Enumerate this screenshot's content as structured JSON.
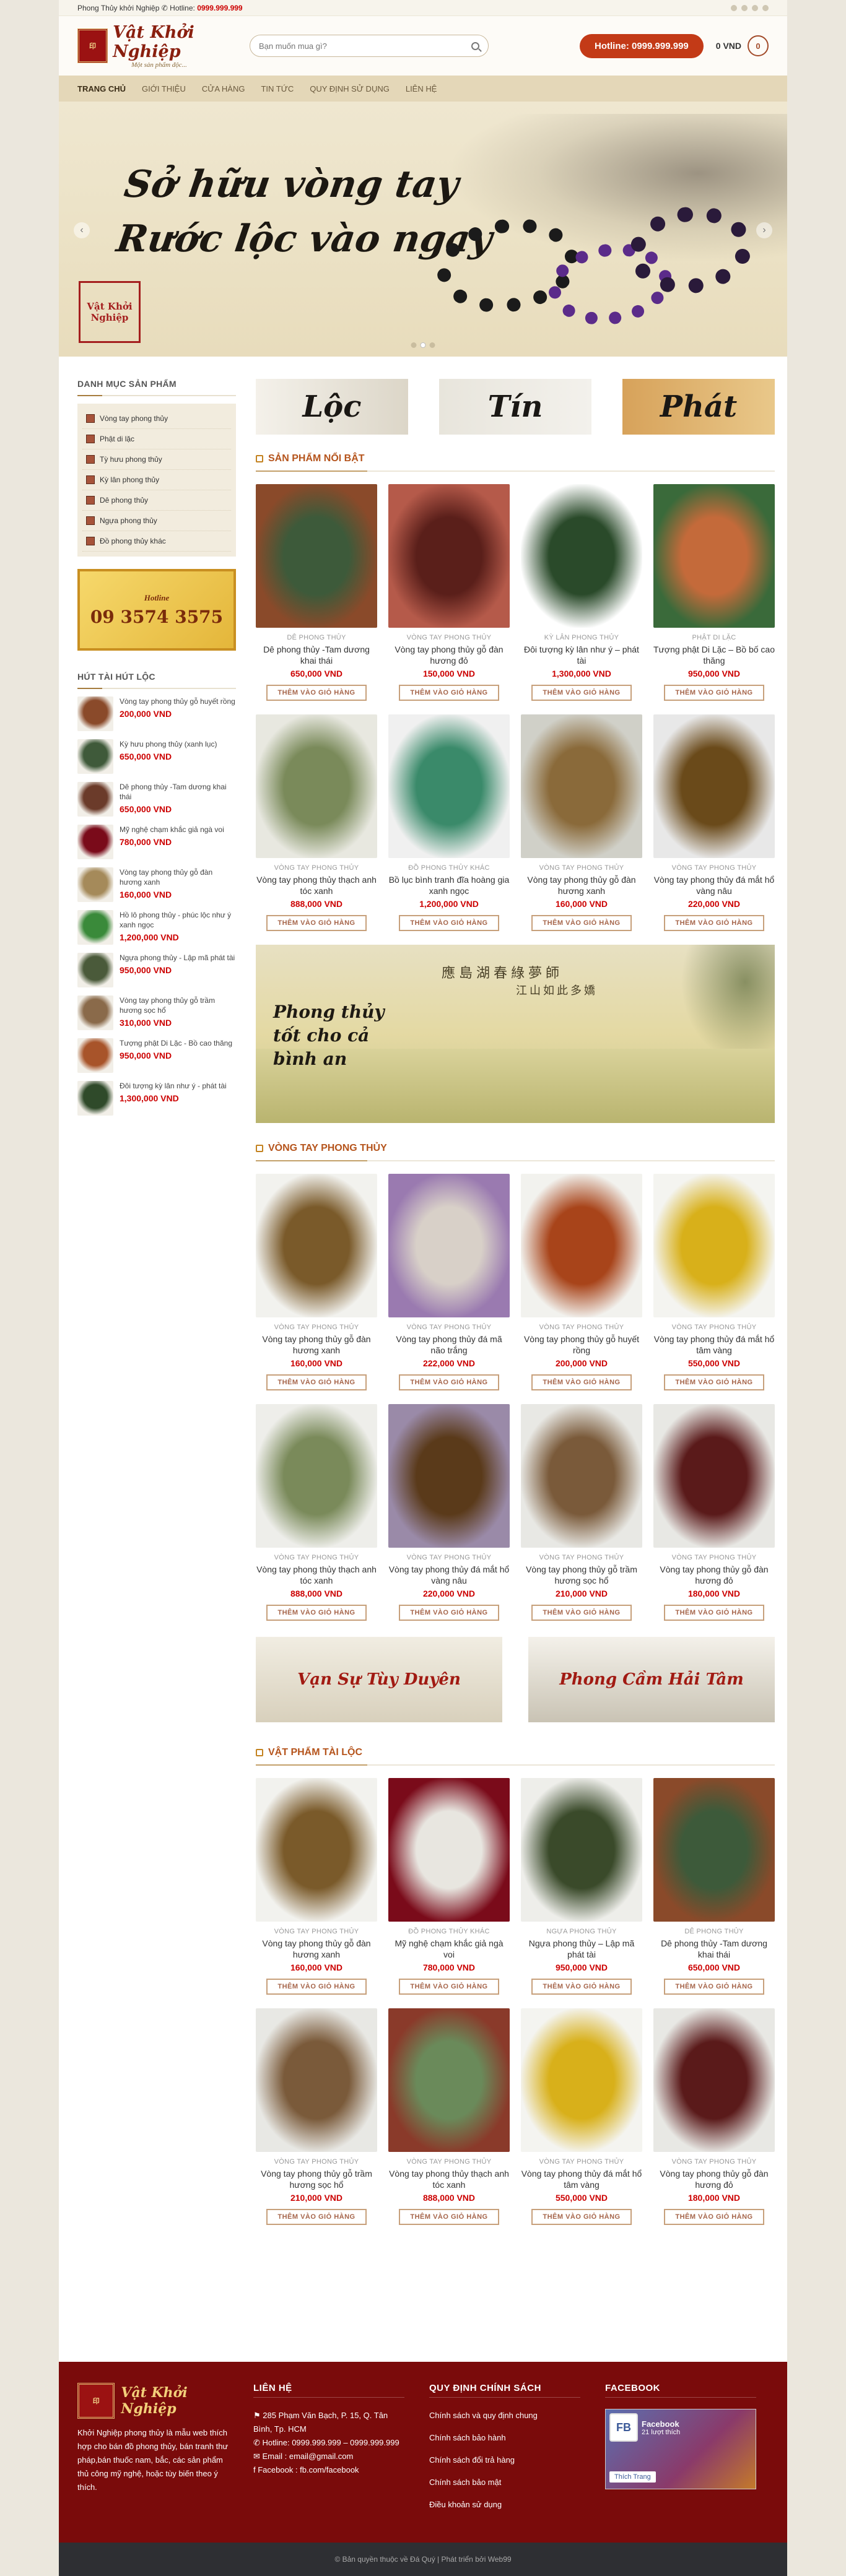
{
  "topbar": {
    "text": "Phong Thủy khởi Nghiệp",
    "hotline_label": "Hotline:",
    "hotline": "0999.999.999"
  },
  "header": {
    "brand": "Vật Khởi Nghiệp",
    "slogan": "Một sản phẩm độc...",
    "search_placeholder": "Bạn muốn mua gì?",
    "hotline_button": "Hotline: 0999.999.999",
    "cart_total": "0 VND",
    "cart_count": "0"
  },
  "nav": [
    "TRANG CHỦ",
    "GIỚI THIỆU",
    "CỬA HÀNG",
    "TIN TỨC",
    "QUY ĐỊNH SỬ DỤNG",
    "LIÊN HỆ"
  ],
  "banner": {
    "line1": "Sở hữu vòng tay",
    "line2": "Rước lộc vào ngay",
    "seal": "Vật Khởi Nghiệp"
  },
  "sidebar": {
    "cat_title": "DANH MỤC SẢN PHẨM",
    "categories": [
      "Vòng tay phong thủy",
      "Phật di lặc",
      "Tỳ hưu phong thủy",
      "Kỳ lân phong thủy",
      "Dê phong thủy",
      "Ngựa phong thủy",
      "Đồ phong thủy khác"
    ],
    "hotbox_label": "Hotline",
    "hotbox_number": "09 3574 3575",
    "hot_title": "HÚT TÀI HÚT LỘC",
    "hot_products": [
      {
        "name": "Vòng tay phong thủy gỗ huyết rồng",
        "price": "200,000 VND",
        "color": "#8a4a2a"
      },
      {
        "name": "Kỳ hưu phong thủy (xanh lục)",
        "price": "650,000 VND",
        "color": "#3f5a3a"
      },
      {
        "name": "Dê phong thủy -Tam dương khai thái",
        "price": "650,000 VND",
        "color": "#6b3b2a"
      },
      {
        "name": "Mỹ nghệ chạm khắc giả ngà voi",
        "price": "780,000 VND",
        "color": "#7a0b1a"
      },
      {
        "name": "Vòng tay phong thủy gỗ đàn hương xanh",
        "price": "160,000 VND",
        "color": "#a58a5a"
      },
      {
        "name": "Hồ lô phong thủy - phúc lộc như ý xanh ngọc",
        "price": "1,200,000 VND",
        "color": "#3a8a3a"
      },
      {
        "name": "Ngựa phong thủy - Lập mã phát tài",
        "price": "950,000 VND",
        "color": "#4a5a3a"
      },
      {
        "name": "Vòng tay phong thủy gỗ trầm hương sọc hổ",
        "price": "310,000 VND",
        "color": "#8a6a4a"
      },
      {
        "name": "Tượng phật Di Lặc - Bồ cao thăng",
        "price": "950,000 VND",
        "color": "#a8542a"
      },
      {
        "name": "Đôi tượng kỳ lân như ý - phát tài",
        "price": "1,300,000 VND",
        "color": "#2f4a2a"
      }
    ]
  },
  "features": [
    "Lộc",
    "Tín",
    "Phát"
  ],
  "sections": [
    {
      "title": "SẢN PHẨM NỔI BẬT",
      "products": [
        {
          "cat": "DÊ PHONG THỦY",
          "name": "Dê phong thủy -Tam dương khai thái",
          "price": "650,000 VND",
          "c1": "#3d5a3a",
          "c2": "#8a4a2a"
        },
        {
          "cat": "VÒNG TAY PHONG THỦY",
          "name": "Vòng tay phong thủy gỗ đàn hương đỏ",
          "price": "150,000 VND",
          "c1": "#5a1f1a",
          "c2": "#b55a4a"
        },
        {
          "cat": "KỲ LÂN PHONG THỦY",
          "name": "Đôi tượng kỳ lân như ý – phát tài",
          "price": "1,300,000 VND",
          "c1": "#2a4a2a",
          "c2": "#ffffff"
        },
        {
          "cat": "PHẬT DI LẶC",
          "name": "Tượng phật Di Lặc – Bồ bố cao thăng",
          "price": "950,000 VND",
          "c1": "#c46a3a",
          "c2": "#3a6a3a"
        },
        {
          "cat": "VÒNG TAY PHONG THỦY",
          "name": "Vòng tay phong thủy thạch anh tóc xanh",
          "price": "888,000 VND",
          "c1": "#7a8a5a",
          "c2": "#e8e8e0"
        },
        {
          "cat": "ĐỒ PHONG THỦY KHÁC",
          "name": "Bồ lục bình tranh đĩa hoàng gia xanh ngọc",
          "price": "1,200,000 VND",
          "c1": "#3a8a6a",
          "c2": "#f0f0f0"
        },
        {
          "cat": "VÒNG TAY PHONG THỦY",
          "name": "Vòng tay phong thủy gỗ đàn hương xanh",
          "price": "160,000 VND",
          "c1": "#8a6a3a",
          "c2": "#d0d0c8"
        },
        {
          "cat": "VÒNG TAY PHONG THỦY",
          "name": "Vòng tay phong thủy đá mắt hổ vàng nâu",
          "price": "220,000 VND",
          "c1": "#6a4a1a",
          "c2": "#e8e8e8"
        }
      ]
    },
    {
      "title": "VÒNG TAY PHONG THỦY",
      "products": [
        {
          "cat": "VÒNG TAY PHONG THỦY",
          "name": "Vòng tay phong thủy gỗ đàn hương xanh",
          "price": "160,000 VND",
          "c1": "#7a5a2a",
          "c2": "#f2f2ee"
        },
        {
          "cat": "VÒNG TAY PHONG THỦY",
          "name": "Vòng tay phong thủy đá mã não trắng",
          "price": "222,000 VND",
          "c1": "#d8d0c8",
          "c2": "#9a7ab0"
        },
        {
          "cat": "VÒNG TAY PHONG THỦY",
          "name": "Vòng tay phong thủy gỗ huyết rồng",
          "price": "200,000 VND",
          "c1": "#a8441a",
          "c2": "#f2f2ee"
        },
        {
          "cat": "VÒNG TAY PHONG THỦY",
          "name": "Vòng tay phong thủy đá mắt hổ tâm vàng",
          "price": "550,000 VND",
          "c1": "#d8b01a",
          "c2": "#f4f4f0"
        },
        {
          "cat": "VÒNG TAY PHONG THỦY",
          "name": "Vòng tay phong thủy thạch anh tóc xanh",
          "price": "888,000 VND",
          "c1": "#7a8a5a",
          "c2": "#eeeeea"
        },
        {
          "cat": "VÒNG TAY PHONG THỦY",
          "name": "Vòng tay phong thủy đá mắt hổ vàng nâu",
          "price": "220,000 VND",
          "c1": "#5a3a1a",
          "c2": "#9a8aa8"
        },
        {
          "cat": "VÒNG TAY PHONG THỦY",
          "name": "Vòng tay phong thủy gỗ trầm hương sọc hổ",
          "price": "210,000 VND",
          "c1": "#7a5a3a",
          "c2": "#e8e8e4"
        },
        {
          "cat": "VÒNG TAY PHONG THỦY",
          "name": "Vòng tay phong thủy gỗ đàn hương đỏ",
          "price": "180,000 VND",
          "c1": "#5a1a1a",
          "c2": "#e8e8e4"
        }
      ]
    },
    {
      "title": "VẬT PHẨM TÀI LỘC",
      "products": [
        {
          "cat": "VÒNG TAY PHONG THỦY",
          "name": "Vòng tay phong thủy gỗ đàn hương xanh",
          "price": "160,000 VND",
          "c1": "#7a5a2a",
          "c2": "#f2f2ee"
        },
        {
          "cat": "ĐỒ PHONG THỦY KHÁC",
          "name": "Mỹ nghệ chạm khắc giả ngà voi",
          "price": "780,000 VND",
          "c1": "#e8e6e0",
          "c2": "#7a0b1a"
        },
        {
          "cat": "NGỰA PHONG THỦY",
          "name": "Ngựa phong thủy – Lập mã phát tài",
          "price": "950,000 VND",
          "c1": "#3a4a2a",
          "c2": "#eeeeea"
        },
        {
          "cat": "DÊ PHONG THỦY",
          "name": "Dê phong thủy -Tam dương khai thái",
          "price": "650,000 VND",
          "c1": "#3d5a3a",
          "c2": "#8a4a2a"
        },
        {
          "cat": "VÒNG TAY PHONG THỦY",
          "name": "Vòng tay phong thủy gỗ trầm hương sọc hổ",
          "price": "210,000 VND",
          "c1": "#7a5a3a",
          "c2": "#e8e8e4"
        },
        {
          "cat": "VÒNG TAY PHONG THỦY",
          "name": "Vòng tay phong thủy thạch anh tóc xanh",
          "price": "888,000 VND",
          "c1": "#6a8a5a",
          "c2": "#8a3a2a"
        },
        {
          "cat": "VÒNG TAY PHONG THỦY",
          "name": "Vòng tay phong thủy đá mắt hổ tâm vàng",
          "price": "550,000 VND",
          "c1": "#d8b01a",
          "c2": "#f4f4f0"
        },
        {
          "cat": "VÒNG TAY PHONG THỦY",
          "name": "Vòng tay phong thủy gỗ đàn hương đỏ",
          "price": "180,000 VND",
          "c1": "#5a1a1a",
          "c2": "#e8e8e4"
        }
      ]
    }
  ],
  "add_to_cart": "THÊM VÀO GIỎ HÀNG",
  "mid_banner": {
    "text1": "Phong thủy tốt cho cả bình an",
    "text2": "應島湖春綠夢師",
    "text3": "江山如此多嬌"
  },
  "duo_banners": [
    "Vạn Sự Tùy Duyên",
    "Phong Cầm Hải Tâm"
  ],
  "footer": {
    "brand": "Vật Khởi Nghiệp",
    "about": "Khởi Nghiệp phong thủy là mẫu web thích hợp cho bán đồ phong thủy, bán tranh thư pháp,bán thuốc nam, bắc, các sản phẩm thủ công mỹ nghệ, hoặc tùy biến theo ý thích.",
    "contact_title": "LIÊN HỆ",
    "contact": [
      "285 Phạm Văn Bạch, P. 15, Q. Tân Bình, Tp. HCM",
      "Hotline: 0999.999.999 – 0999.999.999",
      "Email : email@gmail.com",
      "Facebook : fb.com/facebook"
    ],
    "policy_title": "QUY ĐỊNH CHÍNH SÁCH",
    "policies": [
      "Chính sách và quy định chung",
      "Chính sách bảo hành",
      "Chính sách đổi trả hàng",
      "Chính sách bảo mật",
      "Điều khoản sử dụng"
    ],
    "fb_title": "FACEBOOK",
    "fb_page": "Facebook",
    "fb_likes": "21 lượt thích",
    "fb_like_button": "Thích Trang",
    "copyright": "© Bản quyền thuộc về Đá Quý | Phát triển bởi Web99"
  }
}
